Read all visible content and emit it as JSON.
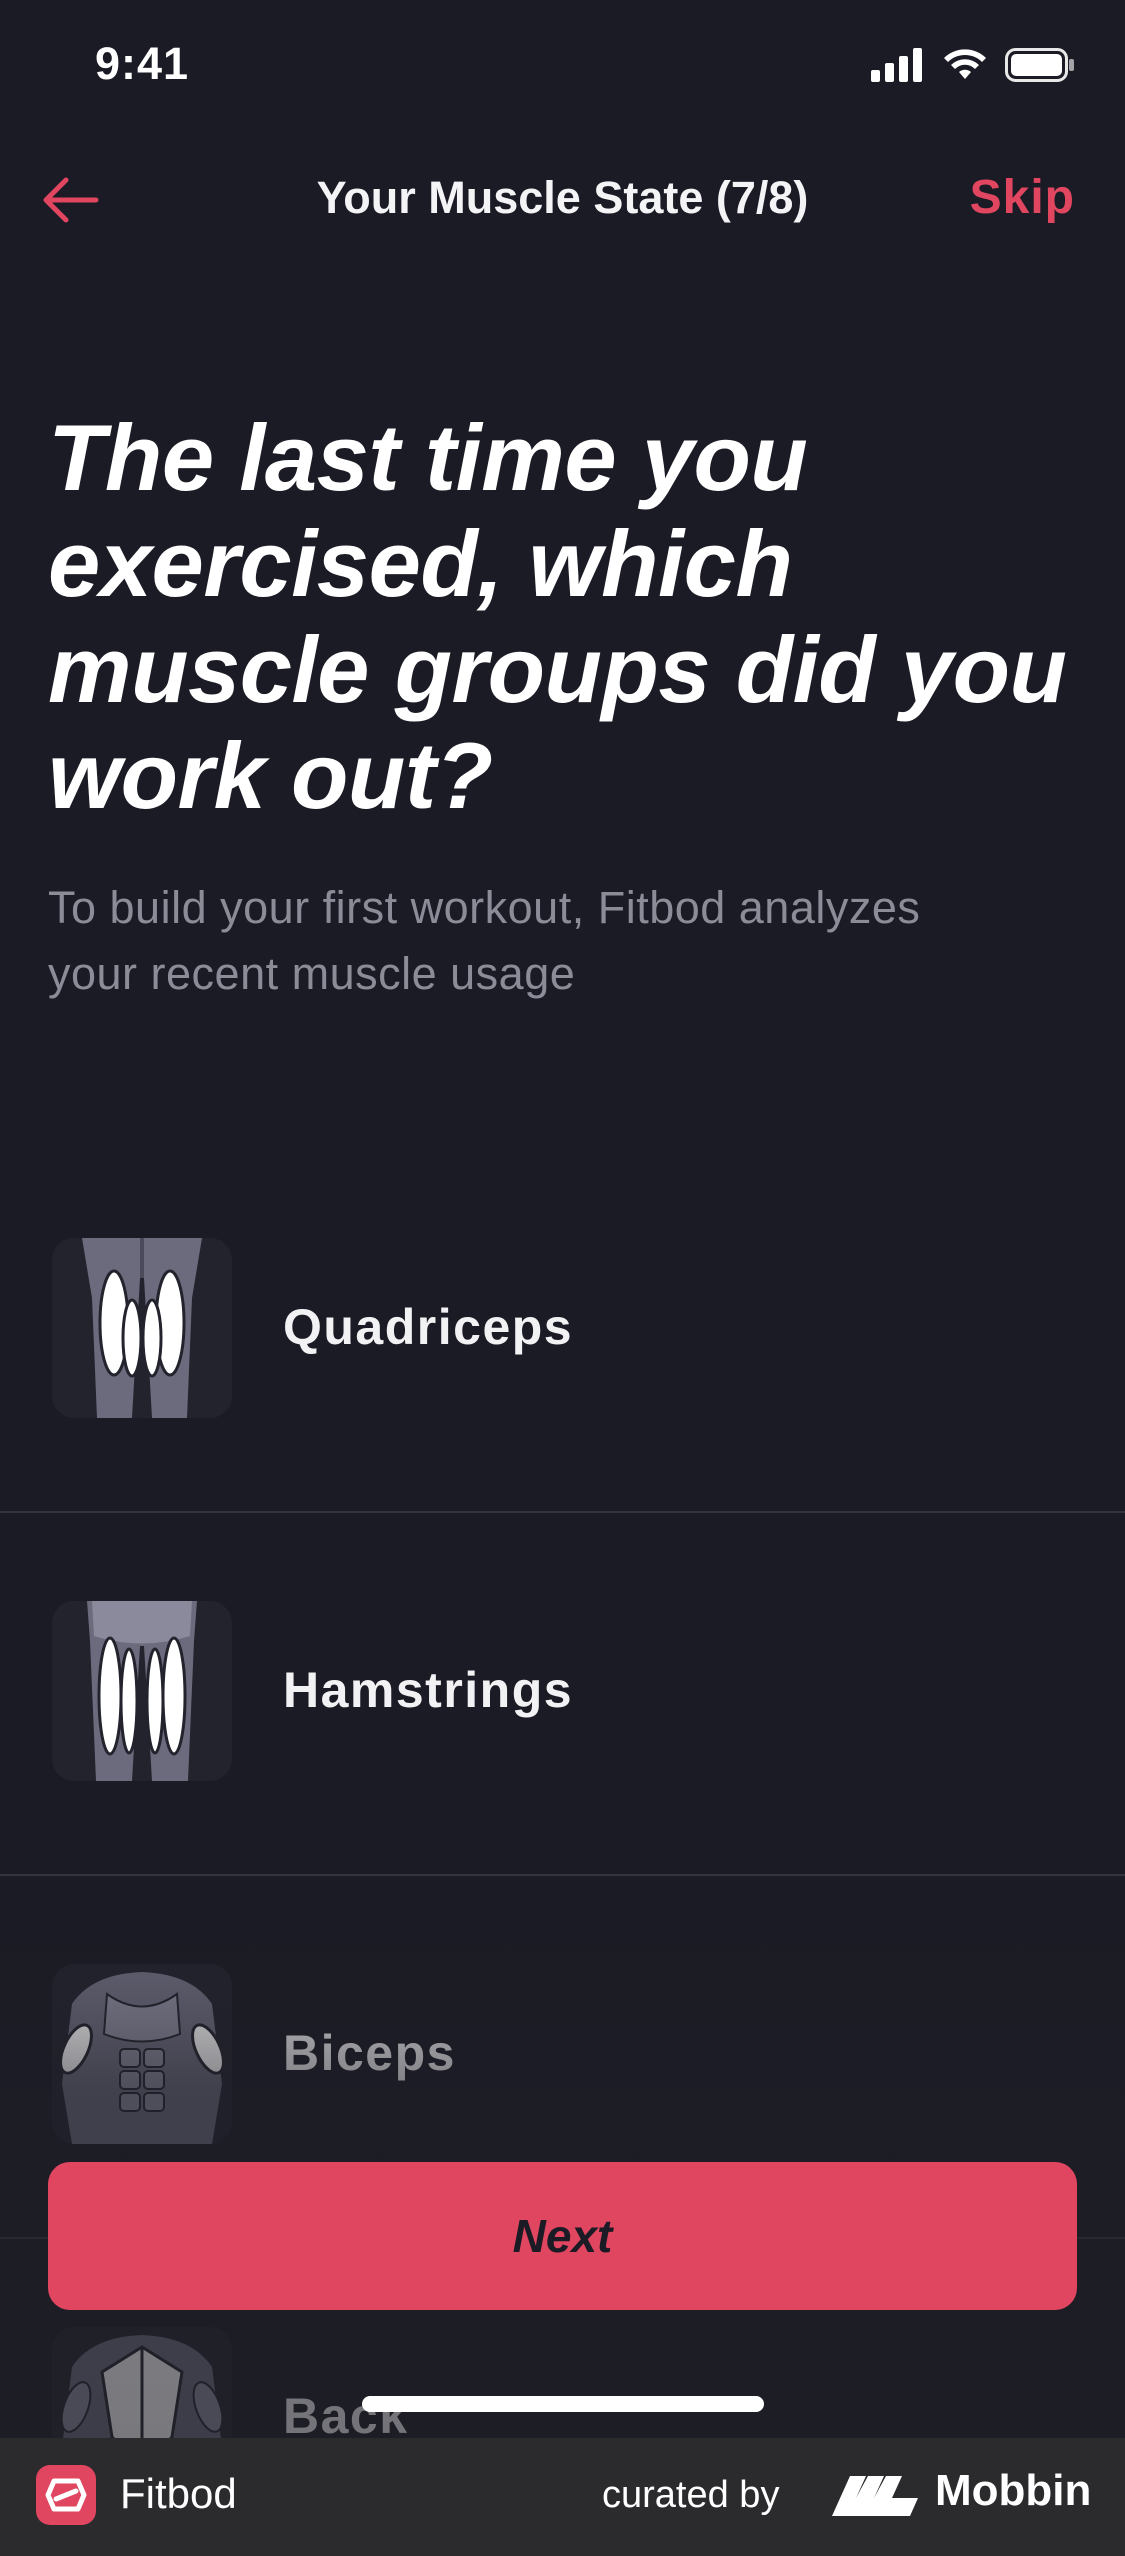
{
  "status_bar": {
    "time": "9:41"
  },
  "nav": {
    "title": "Your Muscle State (7/8)",
    "skip_label": "Skip"
  },
  "question": {
    "lines": [
      "The last time you",
      "exercised, which",
      "muscle groups did you",
      "work out?"
    ],
    "subtitle_lines": [
      "To build your first workout, Fitbod analyzes",
      "your recent muscle usage"
    ]
  },
  "muscles": [
    {
      "label": "Quadriceps",
      "icon": "quadriceps-icon"
    },
    {
      "label": "Hamstrings",
      "icon": "hamstrings-icon"
    },
    {
      "label": "Biceps",
      "icon": "biceps-icon"
    },
    {
      "label": "Back",
      "icon": "back-icon"
    }
  ],
  "next_label": "Next",
  "footer": {
    "app_name": "Fitbod",
    "curated_by": "curated by",
    "brand": "Mobbin"
  },
  "colors": {
    "background": "#1b1b25",
    "accent": "#e0465f",
    "muted_text": "#8c8c99",
    "divider": "#34343f"
  }
}
